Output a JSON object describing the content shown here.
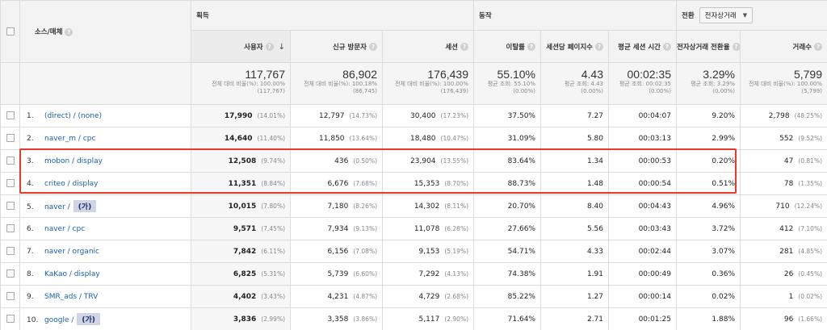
{
  "headers": {
    "source_medium": "소스/매체",
    "group_acquisition": "획득",
    "group_behavior": "동작",
    "group_conversion": "전환",
    "conversion_select": "전자상거래",
    "users": "사용자",
    "new_users": "신규 방문자",
    "sessions": "세션",
    "bounce_rate": "이탈률",
    "pages_per_session": "세션당 페이지수",
    "avg_session_duration": "평균 세션 시간",
    "ecommerce_conv_rate": "전자상거래 전환율",
    "transactions": "거래수"
  },
  "totals": {
    "users": {
      "value": "117,767",
      "note": "전체 대비 비율(%): 100.00% (117,767)"
    },
    "new_users": {
      "value": "86,902",
      "note": "전체 대비 비율(%): 100.18% (86,745)"
    },
    "sessions": {
      "value": "176,439",
      "note": "전체 대비 비율(%): 100.00% (176,439)"
    },
    "bounce_rate": {
      "value": "55.10%",
      "note": "평균 조회: 55.10% (0.00%)"
    },
    "pages_per_session": {
      "value": "4.43",
      "note": "평균 조회: 4.43 (0.00%)"
    },
    "avg_session_duration": {
      "value": "00:02:35",
      "note": "평균 조회: 00:02:35 (0.00%)"
    },
    "ecommerce_conv_rate": {
      "value": "3.29%",
      "note": "평균 조회: 3.29% (0.00%)"
    },
    "transactions": {
      "value": "5,799",
      "note": "전체 대비 비율(%): 100.00% (5,799)"
    }
  },
  "rows": [
    {
      "num": "1.",
      "source": "(direct) / (none)",
      "tag": "",
      "users": "17,990",
      "users_pct": "(14.01%)",
      "new_users": "12,797",
      "new_users_pct": "(14.73%)",
      "sessions": "30,400",
      "sessions_pct": "(17.23%)",
      "bounce": "37.50%",
      "pps": "7.27",
      "dur": "00:04:07",
      "conv": "9.20%",
      "tx": "2,798",
      "tx_pct": "(48.25%)"
    },
    {
      "num": "2.",
      "source": "naver_m / cpc",
      "tag": "",
      "users": "14,640",
      "users_pct": "(11.40%)",
      "new_users": "11,850",
      "new_users_pct": "(13.64%)",
      "sessions": "18,480",
      "sessions_pct": "(10.47%)",
      "bounce": "31.09%",
      "pps": "5.80",
      "dur": "00:03:13",
      "conv": "2.99%",
      "tx": "552",
      "tx_pct": "(9.52%)"
    },
    {
      "num": "3.",
      "source": "mobon / display",
      "tag": "",
      "users": "12,508",
      "users_pct": "(9.74%)",
      "new_users": "436",
      "new_users_pct": "(0.50%)",
      "sessions": "23,904",
      "sessions_pct": "(13.55%)",
      "bounce": "83.64%",
      "pps": "1.34",
      "dur": "00:00:53",
      "conv": "0.20%",
      "tx": "47",
      "tx_pct": "(0.81%)"
    },
    {
      "num": "4.",
      "source": "criteo / display",
      "tag": "",
      "users": "11,351",
      "users_pct": "(8.84%)",
      "new_users": "6,676",
      "new_users_pct": "(7.68%)",
      "sessions": "15,353",
      "sessions_pct": "(8.70%)",
      "bounce": "88.73%",
      "pps": "1.48",
      "dur": "00:00:54",
      "conv": "0.51%",
      "tx": "78",
      "tx_pct": "(1.35%)"
    },
    {
      "num": "5.",
      "source": "naver /",
      "tag": "(가)",
      "users": "10,015",
      "users_pct": "(7.80%)",
      "new_users": "7,180",
      "new_users_pct": "(8.26%)",
      "sessions": "14,302",
      "sessions_pct": "(8.11%)",
      "bounce": "20.70%",
      "pps": "8.40",
      "dur": "00:04:43",
      "conv": "4.96%",
      "tx": "710",
      "tx_pct": "(12.24%)"
    },
    {
      "num": "6.",
      "source": "naver / cpc",
      "tag": "",
      "users": "9,571",
      "users_pct": "(7.45%)",
      "new_users": "7,934",
      "new_users_pct": "(9.13%)",
      "sessions": "11,078",
      "sessions_pct": "(6.28%)",
      "bounce": "27.66%",
      "pps": "5.56",
      "dur": "00:03:43",
      "conv": "3.72%",
      "tx": "412",
      "tx_pct": "(7.10%)"
    },
    {
      "num": "7.",
      "source": "naver / organic",
      "tag": "",
      "users": "7,842",
      "users_pct": "(6.11%)",
      "new_users": "6,156",
      "new_users_pct": "(7.08%)",
      "sessions": "9,153",
      "sessions_pct": "(5.19%)",
      "bounce": "54.71%",
      "pps": "4.33",
      "dur": "00:02:44",
      "conv": "3.07%",
      "tx": "281",
      "tx_pct": "(4.85%)"
    },
    {
      "num": "8.",
      "source": "KaKao / display",
      "tag": "",
      "users": "6,825",
      "users_pct": "(5.31%)",
      "new_users": "5,739",
      "new_users_pct": "(6.60%)",
      "sessions": "7,292",
      "sessions_pct": "(4.13%)",
      "bounce": "74.38%",
      "pps": "1.91",
      "dur": "00:00:49",
      "conv": "0.36%",
      "tx": "26",
      "tx_pct": "(0.45%)"
    },
    {
      "num": "9.",
      "source": "SMR_ads / TRV",
      "tag": "",
      "users": "4,402",
      "users_pct": "(3.43%)",
      "new_users": "4,231",
      "new_users_pct": "(4.87%)",
      "sessions": "4,729",
      "sessions_pct": "(2.68%)",
      "bounce": "85.22%",
      "pps": "1.27",
      "dur": "00:00:14",
      "conv": "0.02%",
      "tx": "1",
      "tx_pct": "(0.02%)"
    },
    {
      "num": "10.",
      "source": "google /",
      "tag": "(가)",
      "users": "3,836",
      "users_pct": "(2.99%)",
      "new_users": "3,358",
      "new_users_pct": "(3.86%)",
      "sessions": "5,117",
      "sessions_pct": "(2.90%)",
      "bounce": "71.64%",
      "pps": "2.71",
      "dur": "00:01:25",
      "conv": "1.88%",
      "tx": "96",
      "tx_pct": "(1.66%)"
    }
  ],
  "icons": {
    "help": "?",
    "sort": "↓",
    "caret": "▼"
  }
}
